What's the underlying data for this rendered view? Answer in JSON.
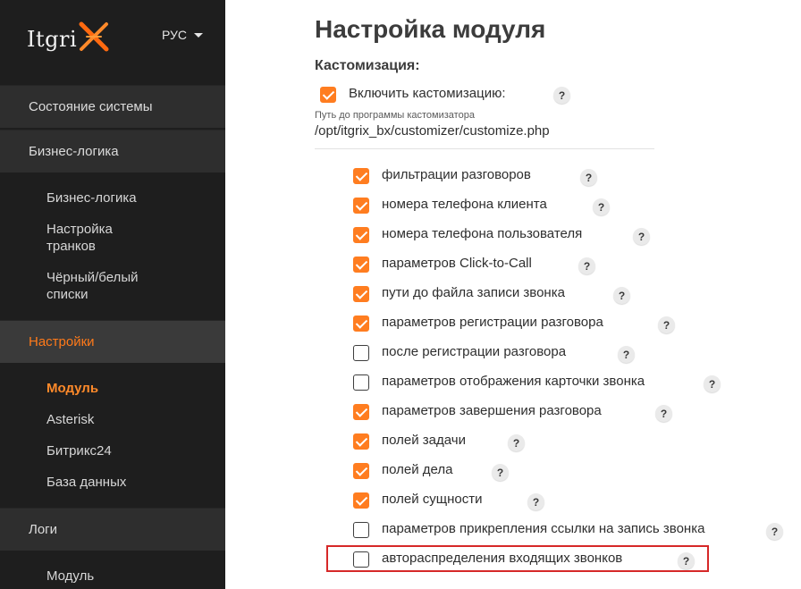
{
  "brand": {
    "logo_text": "Itgri",
    "language": "РУС"
  },
  "sidebar": {
    "sections": [
      {
        "label": "Состояние системы"
      },
      {
        "label": "Бизнес-логика"
      },
      {
        "label": "Настройки"
      },
      {
        "label": "Логи"
      }
    ],
    "business_items": [
      {
        "label": "Бизнес-логика"
      },
      {
        "label": "Настройка транков"
      },
      {
        "label": "Чёрный/белый списки"
      }
    ],
    "settings_items": [
      {
        "label": "Модуль"
      },
      {
        "label": "Asterisk"
      },
      {
        "label": "Битрикс24"
      },
      {
        "label": "База данных"
      }
    ],
    "log_items": [
      {
        "label": "Модуль"
      }
    ]
  },
  "main": {
    "title": "Настройка модуля",
    "section_label": "Кастомизация:",
    "enable_customization": {
      "label": "Включить кастомизацию:",
      "checked": true
    },
    "path_label": "Путь до программы кастомизатора",
    "path_value": "/opt/itgrix_bx/customizer/customize.php",
    "help_label": "?",
    "options": [
      {
        "label": "фильтрации разговоров",
        "checked": true
      },
      {
        "label": "номера телефона клиента",
        "checked": true
      },
      {
        "label": "номера телефона пользователя",
        "checked": true
      },
      {
        "label": "параметров Click-to-Call",
        "checked": true
      },
      {
        "label": "пути до файла записи звонка",
        "checked": true
      },
      {
        "label": "параметров регистрации разговора",
        "checked": true
      },
      {
        "label": "после регистрации разговора",
        "checked": false
      },
      {
        "label": "параметров отображения карточки звонка",
        "checked": false
      },
      {
        "label": "параметров завершения разговора",
        "checked": true
      },
      {
        "label": "полей задачи",
        "checked": true
      },
      {
        "label": "полей дела",
        "checked": true
      },
      {
        "label": "полей сущности",
        "checked": true
      },
      {
        "label": "параметров прикрепления ссылки на запись звонка",
        "checked": false
      },
      {
        "label": "автораспределения входящих звонков",
        "checked": false
      }
    ]
  },
  "colors": {
    "accent": "#ff7d20",
    "sidebar_bg": "#1e1e1e",
    "highlight": "#d62828"
  }
}
